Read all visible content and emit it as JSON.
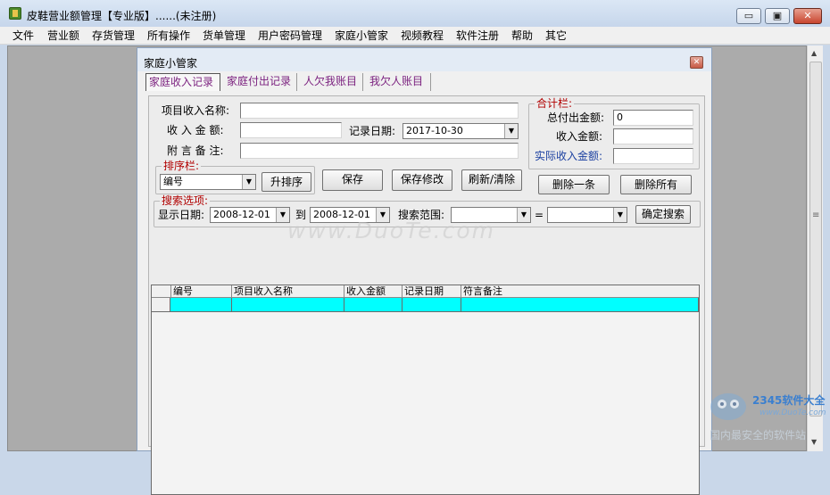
{
  "window": {
    "title": "皮鞋营业额管理【专业版】......(未注册)",
    "minimize": "▭",
    "maximize": "▣",
    "close": "✕"
  },
  "menu": [
    "文件",
    "营业额",
    "存货管理",
    "所有操作",
    "货单管理",
    "用户密码管理",
    "家庭小管家",
    "视频教程",
    "软件注册",
    "帮助",
    "其它"
  ],
  "child": {
    "title": "家庭小管家",
    "close": "✕"
  },
  "tabs": [
    "家庭收入记录",
    "家庭付出记录",
    "人欠我账目",
    "我欠人账目"
  ],
  "form": {
    "item_name_label": "项目收入名称:",
    "item_name_value": "",
    "amount_label": "收 入 金 额:",
    "amount_value": "",
    "date_label": "记录日期:",
    "date_value": "2017-10-30",
    "note_label": "附 言 备 注:",
    "note_value": ""
  },
  "sort": {
    "legend": "排序栏:",
    "field": "编号",
    "sort_button": "升排序"
  },
  "actions": {
    "save": "保存",
    "save_modify": "保存修改",
    "refresh_clear": "刷新/清除",
    "delete_one": "删除一条",
    "delete_all": "删除所有"
  },
  "totals": {
    "legend": "合计栏:",
    "total_pay_label": "总付出金额:",
    "total_pay_value": "0",
    "income_label": "收入金额:",
    "income_value": "",
    "actual_label": "实际收入金额:",
    "actual_value": ""
  },
  "search": {
    "legend": "搜索选项:",
    "show_date_label": "显示日期:",
    "date_from": "2008-12-01",
    "to_label": "到",
    "date_to": "2008-12-01",
    "range_label": "搜索范围:",
    "range_value": "",
    "equals": "=",
    "match_value": "",
    "search_button": "确定搜索"
  },
  "grid": {
    "columns": [
      "编号",
      "项目收入名称",
      "收入金额",
      "记录日期",
      "符言备注"
    ]
  },
  "watermark": {
    "text": "www.DuoTe.com",
    "site_name": "2345软件大全",
    "site_url": "www.DuoTe.com",
    "slogan": "国内最安全的软件站"
  },
  "colors": {
    "grid_row": "#00ffff",
    "tab_text": "#7a1f7e",
    "legend_text": "#b10000",
    "actual_label": "#1a3fa0"
  }
}
